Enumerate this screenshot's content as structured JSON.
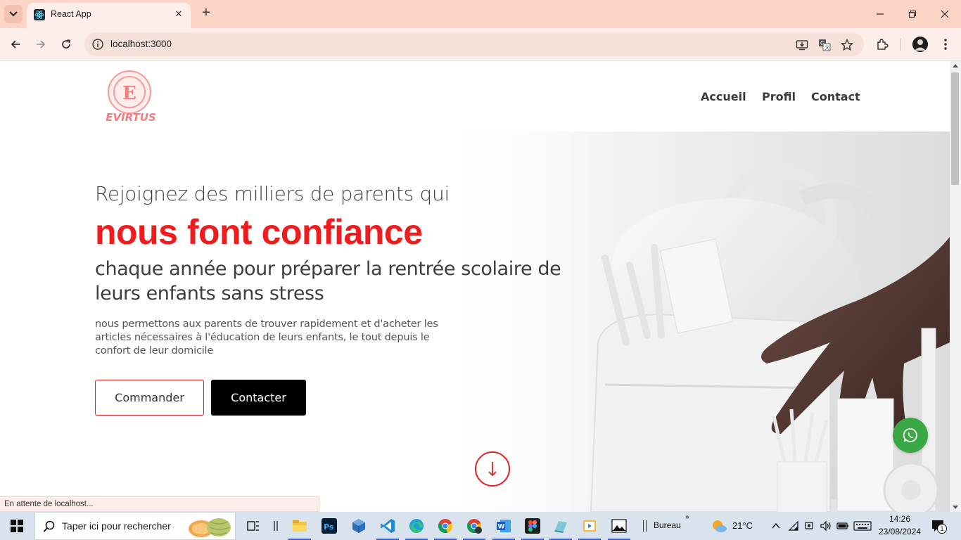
{
  "browser": {
    "tab_title": "React App",
    "url": "localhost:3000",
    "status_text": "En attente de localhost..."
  },
  "site": {
    "logo_text": "EVIRTUS",
    "logo_letter": "E",
    "nav": [
      "Accueil",
      "Profil",
      "Contact"
    ]
  },
  "hero": {
    "line1": "Rejoignez des milliers de parents qui",
    "highlight": "nous font confiance",
    "line2": "chaque année pour préparer la rentrée scolaire de leurs enfants sans stress",
    "description": "nous permettons aux parents de trouver rapidement et d'acheter les articles nécessaires à l'éducation de leurs enfants, le tout depuis le confort de leur domicile",
    "btn_order": "Commander",
    "btn_contact": "Contacter",
    "scroll_arrow": "↓"
  },
  "taskbar": {
    "search_placeholder": "Taper ici pour rechercher",
    "desktop_label": "Bureau",
    "weather": "21°C",
    "time": "14:26",
    "date": "23/08/2024",
    "notifications": "1"
  },
  "colors": {
    "accent_red": "#ee1c1c",
    "whatsapp_green": "#3aa845",
    "tabbar": "#fcd5c6"
  },
  "icons": [
    "tab-list-icon",
    "react-icon",
    "close-icon",
    "plus-icon",
    "minimize-icon",
    "restore-icon",
    "back-icon",
    "forward-icon",
    "reload-icon",
    "info-icon",
    "install-icon",
    "translate-icon",
    "star-icon",
    "extensions-icon",
    "menu-icon",
    "whatsapp-icon",
    "arrow-down-icon",
    "windows-icon",
    "search-icon"
  ]
}
